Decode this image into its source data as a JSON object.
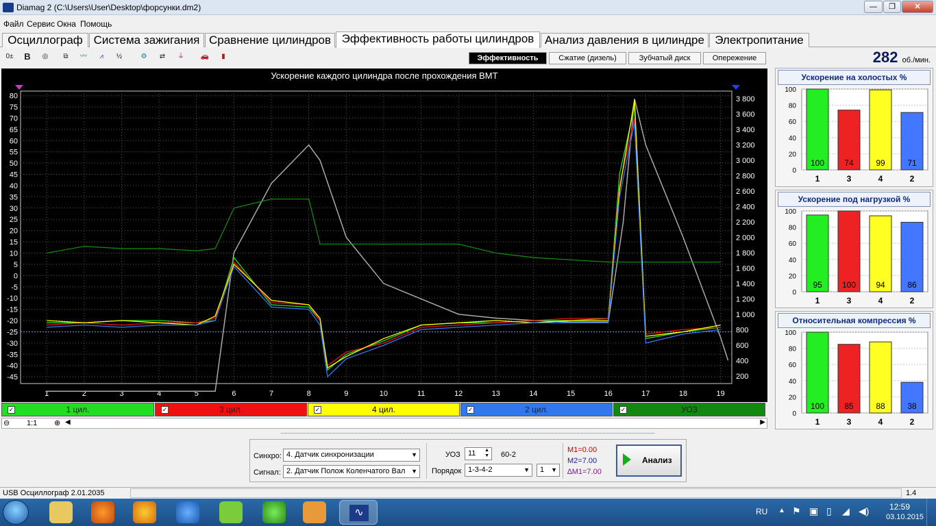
{
  "window": {
    "title": "Diamag 2 (C:\\Users\\User\\Desktop\\форсунки.dm2)"
  },
  "menu": [
    "Файл",
    "Сервис",
    "Окна",
    "Помощь"
  ],
  "tabs": [
    "Осциллограф",
    "Система зажигания",
    "Сравнение цилиндров",
    "Эффективность работы цилиндров",
    "Анализ давления в цилиндре",
    "Электропитание"
  ],
  "active_tab": "Эффективность работы цилиндров",
  "subtabs": [
    "Эффективность",
    "Сжатие (дизель)",
    "Зубчатый диск",
    "Опережение"
  ],
  "rpm": {
    "value": "282",
    "unit": "об./мин."
  },
  "chart": {
    "title": "Ускорение каждого цилиндра после прохождения ВМТ",
    "left_ticks": [
      "80",
      "75",
      "70",
      "65",
      "60",
      "55",
      "50",
      "45",
      "40",
      "35",
      "30",
      "25",
      "20",
      "15",
      "10",
      "5",
      "0",
      "-5",
      "-10",
      "-15",
      "-20",
      "-25",
      "-30",
      "-35",
      "-40",
      "-45"
    ],
    "right_ticks": [
      "3 800",
      "3 600",
      "3 400",
      "3 200",
      "3 000",
      "2 800",
      "2 600",
      "2 400",
      "2 200",
      "2 000",
      "1 800",
      "1 600",
      "1 400",
      "1 200",
      "1 000",
      "800",
      "600",
      "400",
      "200"
    ],
    "x_ticks": [
      "1",
      "2",
      "3",
      "4",
      "5",
      "6",
      "7",
      "8",
      "9",
      "10",
      "11",
      "12",
      "13",
      "14",
      "15",
      "16",
      "17",
      "18",
      "19"
    ]
  },
  "legend": [
    {
      "label": "1 цил.",
      "color": "#22dd22"
    },
    {
      "label": "3 цил.",
      "color": "#ee1111"
    },
    {
      "label": "4 цил.",
      "color": "#ffff00"
    },
    {
      "label": "2 цил.",
      "color": "#3377ee"
    },
    {
      "label": "УОЗ",
      "color": "#118811"
    }
  ],
  "zoom": {
    "label": "1:1"
  },
  "chart_data": [
    {
      "type": "line",
      "title": "Ускорение каждого цилиндра после прохождения ВМТ",
      "x": [
        1,
        2,
        3,
        4,
        5,
        5.5,
        6,
        7,
        8,
        8.3,
        8.5,
        9,
        10,
        11,
        12,
        13,
        14,
        15,
        16,
        16.3,
        16.7,
        17,
        18,
        19
      ],
      "series": [
        {
          "name": "1 цил.",
          "values": [
            -21,
            -21,
            -20,
            -20,
            -21,
            -20,
            8,
            -13,
            -14,
            -20,
            -42,
            -35,
            -29,
            -22,
            -21,
            -21,
            -20,
            -20,
            -19,
            45,
            75,
            -28,
            -25,
            -23
          ]
        },
        {
          "name": "3 цил.",
          "values": [
            -22,
            -21,
            -22,
            -21,
            -21,
            -19,
            6,
            -12,
            -13,
            -20,
            -40,
            -34,
            -30,
            -23,
            -22,
            -21,
            -20,
            -19,
            -19,
            40,
            70,
            -26,
            -24,
            -23
          ]
        },
        {
          "name": "4 цил.",
          "values": [
            -20,
            -21,
            -20,
            -21,
            -22,
            -18,
            5,
            -11,
            -13,
            -19,
            -41,
            -36,
            -28,
            -22,
            -21,
            -20,
            -21,
            -20,
            -20,
            38,
            78,
            -27,
            -25,
            -22
          ]
        },
        {
          "name": "2 цил.",
          "values": [
            -23,
            -22,
            -23,
            -22,
            -22,
            -20,
            4,
            -14,
            -15,
            -22,
            -45,
            -37,
            -31,
            -24,
            -23,
            -22,
            -21,
            -21,
            -21,
            35,
            68,
            -30,
            -26,
            -24
          ]
        },
        {
          "name": "УОЗ",
          "values": [
            10,
            13,
            12,
            12,
            11,
            12,
            30,
            34,
            34,
            14,
            14,
            14,
            14,
            14,
            14,
            10,
            8,
            7,
            6,
            6,
            6,
            6,
            6,
            6
          ]
        }
      ],
      "rpm_series": {
        "x": [
          1,
          4,
          5.5,
          6,
          7,
          8,
          8.3,
          9,
          10,
          11,
          12,
          13,
          14,
          15,
          16,
          16.4,
          16.7,
          17,
          18,
          19,
          19.2
        ],
        "values": [
          0,
          0,
          0,
          1800,
          2700,
          3200,
          3000,
          2000,
          1400,
          1200,
          1000,
          950,
          920,
          900,
          900,
          2200,
          3800,
          3200,
          2000,
          700,
          400
        ]
      },
      "ylim": [
        -48,
        82
      ],
      "y2lim": [
        100,
        3900
      ],
      "xlim": [
        0.3,
        19.3
      ]
    },
    {
      "type": "bar",
      "title": "Ускорение на холостых %",
      "categories": [
        "1",
        "3",
        "4",
        "2"
      ],
      "values": [
        100,
        74,
        99,
        71
      ],
      "ylim": [
        0,
        100
      ],
      "yticks": [
        "100",
        "80",
        "60",
        "40",
        "20",
        "0"
      ]
    },
    {
      "type": "bar",
      "title": "Ускорение под нагрузкой %",
      "categories": [
        "1",
        "3",
        "4",
        "2"
      ],
      "values": [
        95,
        100,
        94,
        86
      ],
      "ylim": [
        0,
        100
      ],
      "yticks": [
        "100",
        "80",
        "60",
        "40",
        "20",
        "0"
      ]
    },
    {
      "type": "bar",
      "title": "Относительная компрессия %",
      "categories": [
        "1",
        "3",
        "4",
        "2"
      ],
      "values": [
        100,
        85,
        88,
        38
      ],
      "ylim": [
        0,
        100
      ],
      "yticks": [
        "100",
        "80",
        "60",
        "40",
        "20",
        "0"
      ]
    }
  ],
  "bar_colors": [
    "#22ee22",
    "#ee2222",
    "#ffff22",
    "#4477ff"
  ],
  "controls": {
    "sync_label": "Синхро:",
    "sync_value": "4.  Датчик синхронизации",
    "signal_label": "Сигнал:",
    "signal_value": "2.  Датчик Полож Коленчатого Вал",
    "uoz_label": "УОЗ",
    "uoz_value": "11",
    "teeth": "60-2",
    "order_label": "Порядок",
    "order_value": "1-3-4-2",
    "order_num": "1",
    "m1": "M1=0.00",
    "m2": "M2=7.00",
    "dm1": "∆M1=7.00",
    "analyze_label": "Анализ"
  },
  "status": {
    "left": "USB Осциллограф  2.01.2035",
    "right": "1.4"
  },
  "taskbar": {
    "lang": "RU",
    "time": "12:59",
    "date": "03.10.2015"
  }
}
